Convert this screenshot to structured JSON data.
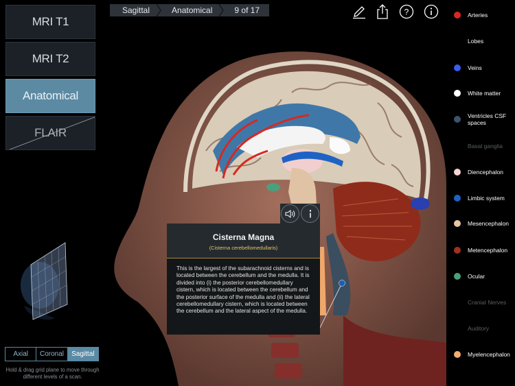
{
  "modes": [
    {
      "label": "MRI T1",
      "active": false
    },
    {
      "label": "MRI T2",
      "active": false
    },
    {
      "label": "Anatomical",
      "active": true
    },
    {
      "label": "FLAIR",
      "active": false,
      "disabled": true
    }
  ],
  "breadcrumb": [
    "Sagittal",
    "Anatomical",
    "9 of 17"
  ],
  "toolbar": {
    "icons": [
      "pencil-icon",
      "share-icon",
      "help-icon",
      "info-icon"
    ]
  },
  "legend": [
    {
      "label": "Arteries",
      "color": "#d8281f",
      "enabled": true
    },
    {
      "label": "Lobes",
      "color": null,
      "enabled": true
    },
    {
      "label": "Veins",
      "color": "#3a5cf0",
      "enabled": true
    },
    {
      "label": "White matter",
      "color": "#ffffff",
      "enabled": true
    },
    {
      "label": "Ventricles CSF spaces",
      "color": "#3d5369",
      "enabled": true
    },
    {
      "label": "Basal ganglia",
      "color": null,
      "enabled": false
    },
    {
      "label": "Diencephalon",
      "color": "#f7d3d4",
      "enabled": true
    },
    {
      "label": "Limbic system",
      "color": "#1e63c4",
      "enabled": true
    },
    {
      "label": "Mesencephalon",
      "color": "#e3c4a5",
      "enabled": true
    },
    {
      "label": "Metencephalon",
      "color": "#a0311e",
      "enabled": true
    },
    {
      "label": "Ocular",
      "color": "#4aa07c",
      "enabled": true
    },
    {
      "label": "Cranial Nerves",
      "color": null,
      "enabled": false
    },
    {
      "label": "Auditory",
      "color": null,
      "enabled": false
    },
    {
      "label": "Myelencephalon",
      "color": "#f4ad6c",
      "enabled": true
    }
  ],
  "popup": {
    "title": "Cisterna Magna",
    "subtitle": "(Cisterna cerebellomedullaris)",
    "body": "This is the largest of the subarachnoid cisterns and is located between the cerebellum and the medulla. It is divided into (i) the posterior cerebellomedullary cistern, which is located between the cerebellum and the posterior surface of the medulla and (ii) the lateral cerebellomedullary cistern, which is located between the cerebellum and the lateral aspect of the medulla.",
    "buttons": [
      "speaker-icon",
      "info-icon"
    ]
  },
  "planes": [
    {
      "label": "Axial",
      "active": false
    },
    {
      "label": "Coronal",
      "active": false
    },
    {
      "label": "Sagittal",
      "active": true
    }
  ],
  "hint": "Hold & drag grid plane to move through different levels of a scan."
}
